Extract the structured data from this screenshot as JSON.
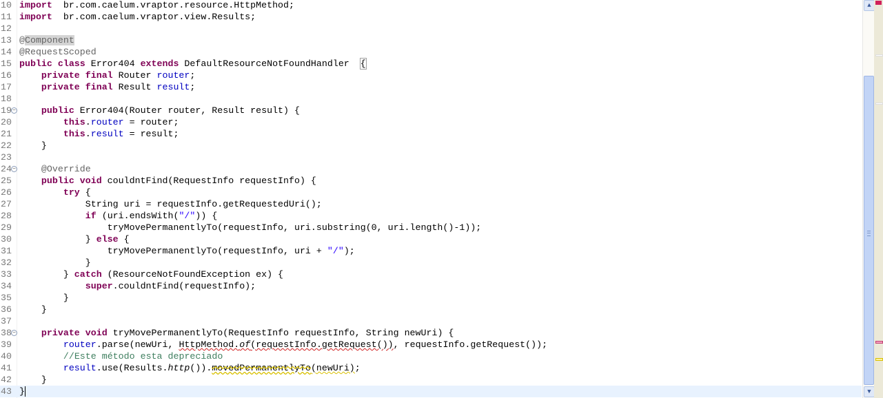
{
  "editor": {
    "current_line": 43,
    "lines": [
      {
        "n": "10",
        "tokens": [
          [
            "kw",
            "import"
          ],
          [
            "",
            "  br.com.caelum.vraptor.resource.HttpMethod;"
          ]
        ]
      },
      {
        "n": "11",
        "tokens": [
          [
            "kw",
            "import"
          ],
          [
            "",
            "  br.com.caelum.vraptor.view.Results;"
          ]
        ]
      },
      {
        "n": "12",
        "tokens": []
      },
      {
        "n": "13",
        "tokens": [
          [
            "ann",
            "@"
          ],
          [
            "ann hl",
            "Component"
          ]
        ]
      },
      {
        "n": "14",
        "tokens": [
          [
            "ann",
            "@RequestScoped"
          ]
        ]
      },
      {
        "n": "15",
        "tokens": [
          [
            "kw",
            "public class"
          ],
          [
            "",
            " Error404 "
          ],
          [
            "kw",
            "extends"
          ],
          [
            "",
            " DefaultResourceNotFoundHandler  "
          ],
          [
            "box",
            "{"
          ]
        ]
      },
      {
        "n": "16",
        "tokens": [
          [
            "",
            "    "
          ],
          [
            "kw",
            "private final"
          ],
          [
            "",
            " Router "
          ],
          [
            "fld",
            "router"
          ],
          [
            "",
            ";"
          ]
        ]
      },
      {
        "n": "17",
        "tokens": [
          [
            "",
            "    "
          ],
          [
            "kw",
            "private final"
          ],
          [
            "",
            " Result "
          ],
          [
            "fld",
            "result"
          ],
          [
            "",
            ";"
          ]
        ]
      },
      {
        "n": "18",
        "tokens": []
      },
      {
        "n": "19",
        "fold": true,
        "tokens": [
          [
            "",
            "    "
          ],
          [
            "kw",
            "public"
          ],
          [
            "",
            " Error404(Router router, Result result) {"
          ]
        ]
      },
      {
        "n": "20",
        "tokens": [
          [
            "",
            "        "
          ],
          [
            "kw",
            "this"
          ],
          [
            "",
            "."
          ],
          [
            "fld",
            "router"
          ],
          [
            "",
            " = router;"
          ]
        ]
      },
      {
        "n": "21",
        "tokens": [
          [
            "",
            "        "
          ],
          [
            "kw",
            "this"
          ],
          [
            "",
            "."
          ],
          [
            "fld",
            "result"
          ],
          [
            "",
            " = result;"
          ]
        ]
      },
      {
        "n": "22",
        "tokens": [
          [
            "",
            "    }"
          ]
        ]
      },
      {
        "n": "23",
        "tokens": []
      },
      {
        "n": "24",
        "fold": true,
        "tokens": [
          [
            "",
            "    "
          ],
          [
            "ann",
            "@Override"
          ]
        ]
      },
      {
        "n": "25",
        "tokens": [
          [
            "",
            "    "
          ],
          [
            "kw",
            "public void"
          ],
          [
            "",
            " couldntFind(RequestInfo requestInfo) {"
          ]
        ]
      },
      {
        "n": "26",
        "tokens": [
          [
            "",
            "        "
          ],
          [
            "kw",
            "try"
          ],
          [
            "",
            " {"
          ]
        ]
      },
      {
        "n": "27",
        "tokens": [
          [
            "",
            "            String uri = requestInfo.getRequestedUri();"
          ]
        ]
      },
      {
        "n": "28",
        "tokens": [
          [
            "",
            "            "
          ],
          [
            "kw",
            "if"
          ],
          [
            "",
            " (uri.endsWith("
          ],
          [
            "str",
            "\"/\""
          ],
          [
            "",
            ")) {"
          ]
        ]
      },
      {
        "n": "29",
        "tokens": [
          [
            "",
            "                tryMovePermanentlyTo(requestInfo, uri.substring(0, uri.length()-1));"
          ]
        ]
      },
      {
        "n": "30",
        "tokens": [
          [
            "",
            "            } "
          ],
          [
            "kw",
            "else"
          ],
          [
            "",
            " {"
          ]
        ]
      },
      {
        "n": "31",
        "tokens": [
          [
            "",
            "                tryMovePermanentlyTo(requestInfo, uri + "
          ],
          [
            "str",
            "\"/\""
          ],
          [
            "",
            ");"
          ]
        ]
      },
      {
        "n": "32",
        "tokens": [
          [
            "",
            "            }"
          ]
        ]
      },
      {
        "n": "33",
        "tokens": [
          [
            "",
            "        } "
          ],
          [
            "kw",
            "catch"
          ],
          [
            "",
            " (ResourceNotFoundException ex) {"
          ]
        ]
      },
      {
        "n": "34",
        "tokens": [
          [
            "",
            "            "
          ],
          [
            "kw",
            "super"
          ],
          [
            "",
            ".couldntFind(requestInfo);"
          ]
        ]
      },
      {
        "n": "35",
        "tokens": [
          [
            "",
            "        }"
          ]
        ]
      },
      {
        "n": "36",
        "tokens": [
          [
            "",
            "    }"
          ]
        ]
      },
      {
        "n": "37",
        "tokens": []
      },
      {
        "n": "38",
        "fold": true,
        "tokens": [
          [
            "",
            "    "
          ],
          [
            "kw",
            "private void"
          ],
          [
            "",
            " tryMovePermanentlyTo(RequestInfo requestInfo, String newUri) {"
          ]
        ]
      },
      {
        "n": "39",
        "tokens": [
          [
            "",
            "        "
          ],
          [
            "fld",
            "router"
          ],
          [
            "",
            ".parse(newUri, "
          ],
          [
            "err",
            "HttpMethod."
          ],
          [
            "err it",
            "of"
          ],
          [
            "err",
            "(requestInfo.getRequest())"
          ],
          [
            "",
            ", requestInfo.getRequest());"
          ]
        ]
      },
      {
        "n": "40",
        "tokens": [
          [
            "",
            "        "
          ],
          [
            "cm",
            "//"
          ],
          [
            "cm spellw",
            "Este"
          ],
          [
            "cm",
            " "
          ],
          [
            "cm spellw",
            "método"
          ],
          [
            "cm",
            " "
          ],
          [
            "cm spellw",
            "esta"
          ],
          [
            "cm",
            " "
          ],
          [
            "cm spellw",
            "depreciado"
          ]
        ]
      },
      {
        "n": "41",
        "tokens": [
          [
            "",
            "        "
          ],
          [
            "fld",
            "result"
          ],
          [
            "",
            ".use(Results."
          ],
          [
            "it",
            "http"
          ],
          [
            "",
            "())."
          ],
          [
            "strike warn",
            "movedPermanentlyTo"
          ],
          [
            "warn",
            "(newUri)"
          ],
          [
            "",
            ";"
          ]
        ]
      },
      {
        "n": "42",
        "tokens": [
          [
            "",
            "    }"
          ]
        ]
      },
      {
        "n": "43",
        "tokens": [
          [
            "",
            "}"
          ]
        ]
      }
    ]
  },
  "colors": {
    "keyword": "#7f0055",
    "field": "#0000c0",
    "annotation": "#646464",
    "comment": "#3f7f5f",
    "current_line": "#e8f2fe"
  },
  "scrollbar": {
    "up_icon": "chevron-up-icon",
    "down_icon": "chevron-down-icon"
  }
}
